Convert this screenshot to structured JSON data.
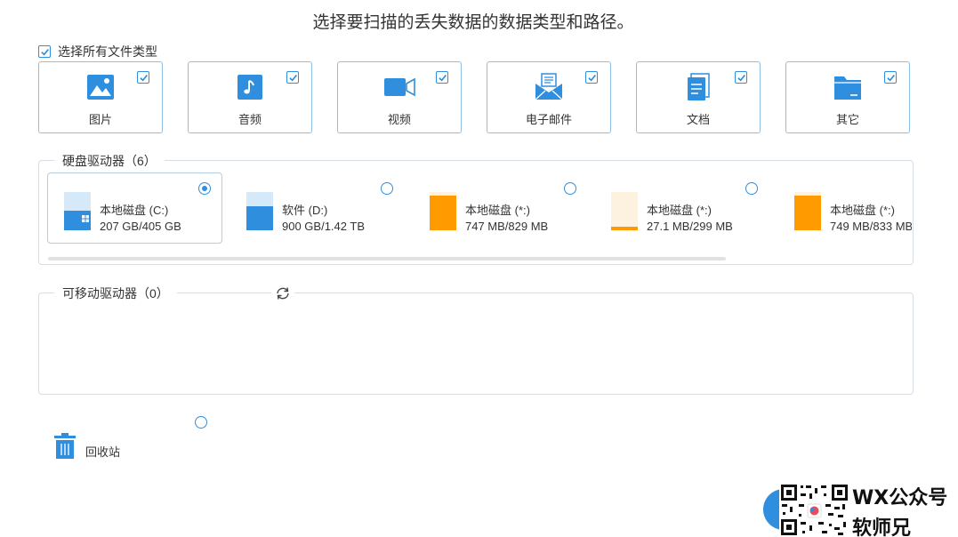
{
  "title": "选择要扫描的丢失数据的数据类型和路径。",
  "select_all": {
    "label": "选择所有文件类型",
    "checked": true
  },
  "file_types": [
    {
      "label": "图片",
      "icon": "image-icon",
      "checked": true
    },
    {
      "label": "音频",
      "icon": "music-icon",
      "checked": true
    },
    {
      "label": "视频",
      "icon": "video-icon",
      "checked": true
    },
    {
      "label": "电子邮件",
      "icon": "email-icon",
      "checked": true
    },
    {
      "label": "文档",
      "icon": "document-icon",
      "checked": true
    },
    {
      "label": "其它",
      "icon": "folder-icon",
      "checked": true
    }
  ],
  "hard_drives": {
    "legend": "硬盘驱动器（6）",
    "drives": [
      {
        "name": "本地磁盘 (C:)",
        "size": "207 GB/405 GB",
        "used_fraction": 0.51,
        "system": true,
        "selected": true
      },
      {
        "name": "软件 (D:)",
        "size": "900 GB/1.42 TB",
        "used_fraction": 0.62,
        "system": false,
        "selected": false
      },
      {
        "name": "本地磁盘 (*:)",
        "size": "747 MB/829 MB",
        "used_fraction": 0.9,
        "system": false,
        "selected": false
      },
      {
        "name": "本地磁盘 (*:)",
        "size": "27.1 MB/299 MB",
        "used_fraction": 0.09,
        "system": false,
        "selected": false
      },
      {
        "name": "本地磁盘 (*:)",
        "size": "749 MB/833 MB",
        "used_fraction": 0.9,
        "system": false,
        "selected": false
      }
    ]
  },
  "removable_drives": {
    "legend": "可移动驱动器（0）"
  },
  "recycle_bin": {
    "label": "回收站",
    "selected": false
  },
  "watermark": {
    "line1": "WX公众号",
    "line2": "软师兄"
  },
  "colors": {
    "accent": "#2f8fde",
    "drive_blue": "#2f8fde",
    "drive_light": "#d5e9f8",
    "drive_orange": "#ff9a00",
    "drive_orange_light": "#fdf1df"
  }
}
